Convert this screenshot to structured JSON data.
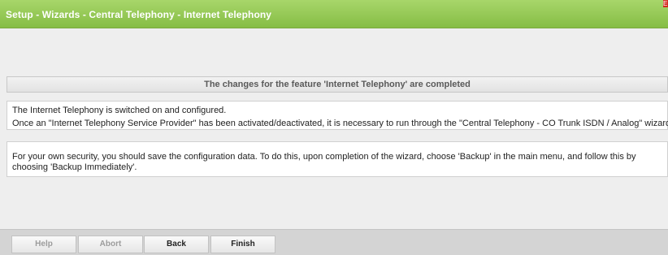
{
  "header": {
    "title": "Setup - Wizards - Central Telephony - Internet Telephony",
    "corner_marker": "E"
  },
  "main": {
    "section_title": "The changes for the feature 'Internet Telephony' are completed",
    "status_lines": [
      "The Internet Telephony is switched on and configured.",
      "Once an \"Internet Telephony Service Provider\" has been activated/deactivated, it is necessary to run through the \"Central Telephony - CO Trunk ISDN / Analog\" wizard again."
    ],
    "security_note": "For your own security, you should save the configuration data. To do this, upon completion of the wizard, choose 'Backup' in the main menu, and follow this by choosing 'Backup Immediately'."
  },
  "footer": {
    "buttons": [
      {
        "label": "Help",
        "enabled": false
      },
      {
        "label": "Abort",
        "enabled": false
      },
      {
        "label": "Back",
        "enabled": true
      },
      {
        "label": "Finish",
        "enabled": true
      }
    ]
  },
  "colors": {
    "titlebar": "#95c853",
    "titlebar_text": "#ffffff",
    "page_background": "#eeeeee",
    "corner_marker": "#d22a1e"
  }
}
